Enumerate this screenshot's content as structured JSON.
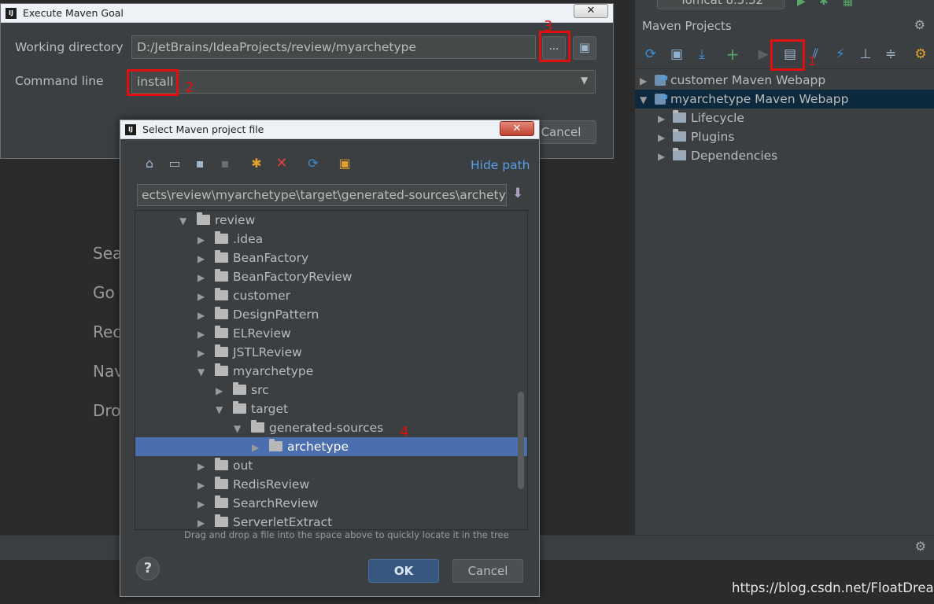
{
  "background_hints": [
    "Sea",
    "Go",
    "Rec",
    "Nav",
    "Dro"
  ],
  "top_bar": {
    "run_config": "Tomcat 8.5.32"
  },
  "maven_panel": {
    "title": "Maven Projects",
    "settings_icon": "⚙",
    "projects": [
      {
        "label": "customer Maven Webapp",
        "expanded": false,
        "selected": false
      },
      {
        "label": "myarchetype Maven Webapp",
        "expanded": true,
        "selected": true
      }
    ],
    "children": [
      "Lifecycle",
      "Plugins",
      "Dependencies"
    ],
    "annotation": "1"
  },
  "execute_dialog": {
    "title": "Execute Maven Goal",
    "close_label": "✕",
    "working_directory_label": "Working directory",
    "working_directory_value": "D:/JetBrains/IdeaProjects/review/myarchetype",
    "browse_label": "...",
    "command_line_label": "Command line",
    "command_line_value": "install",
    "cancel_label": "Cancel",
    "annotation_command": "2",
    "annotation_browse": "3"
  },
  "select_dialog": {
    "title": "Select Maven project file",
    "close_label": "✕",
    "hide_path_label": "Hide path",
    "path_value": "ects\\review\\myarchetype\\target\\generated-sources\\archetype",
    "tree": [
      {
        "label": "review",
        "depth": 0,
        "expanded": true
      },
      {
        "label": ".idea",
        "depth": 1,
        "expanded": false
      },
      {
        "label": "BeanFactory",
        "depth": 1,
        "expanded": false
      },
      {
        "label": "BeanFactoryReview",
        "depth": 1,
        "expanded": false
      },
      {
        "label": "customer",
        "depth": 1,
        "expanded": false
      },
      {
        "label": "DesignPattern",
        "depth": 1,
        "expanded": false
      },
      {
        "label": "ELReview",
        "depth": 1,
        "expanded": false
      },
      {
        "label": "JSTLReview",
        "depth": 1,
        "expanded": false
      },
      {
        "label": "myarchetype",
        "depth": 1,
        "expanded": true
      },
      {
        "label": "src",
        "depth": 2,
        "expanded": false
      },
      {
        "label": "target",
        "depth": 2,
        "expanded": true
      },
      {
        "label": "generated-sources",
        "depth": 3,
        "expanded": true
      },
      {
        "label": "archetype",
        "depth": 4,
        "expanded": false,
        "selected": true
      },
      {
        "label": "out",
        "depth": 1,
        "expanded": false
      },
      {
        "label": "RedisReview",
        "depth": 1,
        "expanded": false
      },
      {
        "label": "SearchReview",
        "depth": 1,
        "expanded": false
      },
      {
        "label": "ServerletExtract",
        "depth": 1,
        "expanded": false
      }
    ],
    "drag_hint": "Drag and drop a file into the space above to quickly locate it in the tree",
    "ok_label": "OK",
    "cancel_label": "Cancel",
    "help_label": "?",
    "annotation_selected": "4"
  },
  "watermark": "https://blog.csdn.net/FloatDreamed",
  "colors": {
    "accent_selection": "#4b6eaf",
    "annotation_red": "#e01010",
    "panel_bg": "#3c3f41"
  }
}
